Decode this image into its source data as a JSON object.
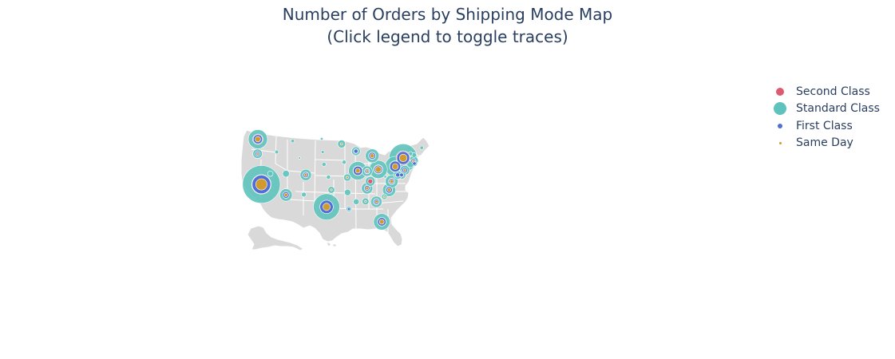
{
  "chart": {
    "title_line1": "Number of Orders by Shipping Mode Map",
    "title_line2": "(Click legend to toggle traces)"
  },
  "colors": {
    "land": "#d9d9d9",
    "borders": "#ffffff",
    "second_class": "#dc5b71",
    "standard_class": "#5fc3bd",
    "first_class": "#4f6fd6",
    "same_day": "#d09a2c",
    "text": "#2a3f5f"
  },
  "chart_data": {
    "type": "scatter_geo",
    "scope": "usa",
    "title": "Number of Orders by Shipping Mode Map\n(Click legend to toggle traces)",
    "legend_position": "top-right",
    "series": [
      {
        "name": "Second Class",
        "color": "#dc5b71",
        "points": [
          {
            "state": "California",
            "lon": -119.4,
            "lat": 36.8,
            "value": 320
          },
          {
            "state": "New York",
            "lon": -75.0,
            "lat": 43.0,
            "value": 170
          },
          {
            "state": "Texas",
            "lon": -99.0,
            "lat": 31.5,
            "value": 150
          },
          {
            "state": "Pennsylvania",
            "lon": -77.5,
            "lat": 41.0,
            "value": 110
          },
          {
            "state": "Washington",
            "lon": -120.5,
            "lat": 47.4,
            "value": 90
          },
          {
            "state": "Illinois",
            "lon": -89.2,
            "lat": 40.0,
            "value": 80
          },
          {
            "state": "Ohio",
            "lon": -82.8,
            "lat": 40.3,
            "value": 70
          },
          {
            "state": "Florida",
            "lon": -81.7,
            "lat": 28.0,
            "value": 60
          },
          {
            "state": "Michigan",
            "lon": -84.7,
            "lat": 43.5,
            "value": 45
          },
          {
            "state": "North Carolina",
            "lon": -79.4,
            "lat": 35.5,
            "value": 40
          },
          {
            "state": "Virginia",
            "lon": -78.6,
            "lat": 37.5,
            "value": 35
          },
          {
            "state": "Arizona",
            "lon": -111.7,
            "lat": 34.3,
            "value": 35
          },
          {
            "state": "Georgia",
            "lon": -83.4,
            "lat": 32.7,
            "value": 30
          },
          {
            "state": "Tennessee",
            "lon": -86.3,
            "lat": 35.9,
            "value": 28
          },
          {
            "state": "Colorado",
            "lon": -105.5,
            "lat": 39.0,
            "value": 28
          },
          {
            "state": "Indiana",
            "lon": -86.3,
            "lat": 39.9,
            "value": 25
          },
          {
            "state": "Kentucky",
            "lon": -85.3,
            "lat": 37.5,
            "value": 20
          },
          {
            "state": "New Jersey",
            "lon": -74.5,
            "lat": 40.1,
            "value": 22
          },
          {
            "state": "Massachusetts",
            "lon": -71.8,
            "lat": 42.3,
            "value": 20
          },
          {
            "state": "Delaware",
            "lon": -75.5,
            "lat": 39.0,
            "value": 15
          },
          {
            "state": "Wisconsin",
            "lon": -89.8,
            "lat": 44.6,
            "value": 18
          },
          {
            "state": "Oregon",
            "lon": -120.6,
            "lat": 44.0,
            "value": 18
          }
        ]
      },
      {
        "name": "Standard Class",
        "color": "#5fc3bd",
        "points": [
          {
            "state": "California",
            "lon": -119.4,
            "lat": 36.8,
            "value": 1200
          },
          {
            "state": "New York",
            "lon": -75.0,
            "lat": 43.0,
            "value": 680
          },
          {
            "state": "Texas",
            "lon": -99.0,
            "lat": 31.5,
            "value": 590
          },
          {
            "state": "Pennsylvania",
            "lon": -77.5,
            "lat": 41.0,
            "value": 350
          },
          {
            "state": "Washington",
            "lon": -120.5,
            "lat": 47.4,
            "value": 310
          },
          {
            "state": "Illinois",
            "lon": -89.2,
            "lat": 40.0,
            "value": 290
          },
          {
            "state": "Ohio",
            "lon": -82.8,
            "lat": 40.3,
            "value": 280
          },
          {
            "state": "Florida",
            "lon": -81.7,
            "lat": 28.0,
            "value": 230
          },
          {
            "state": "Michigan",
            "lon": -84.7,
            "lat": 43.5,
            "value": 160
          },
          {
            "state": "North Carolina",
            "lon": -79.4,
            "lat": 35.5,
            "value": 150
          },
          {
            "state": "Virginia",
            "lon": -78.6,
            "lat": 37.5,
            "value": 140
          },
          {
            "state": "Arizona",
            "lon": -111.7,
            "lat": 34.3,
            "value": 130
          },
          {
            "state": "Georgia",
            "lon": -83.4,
            "lat": 32.7,
            "value": 110
          },
          {
            "state": "Tennessee",
            "lon": -86.3,
            "lat": 35.9,
            "value": 110
          },
          {
            "state": "Colorado",
            "lon": -105.5,
            "lat": 39.0,
            "value": 110
          },
          {
            "state": "Indiana",
            "lon": -86.3,
            "lat": 39.9,
            "value": 90
          },
          {
            "state": "Kentucky",
            "lon": -85.3,
            "lat": 37.5,
            "value": 80
          },
          {
            "state": "New Jersey",
            "lon": -74.5,
            "lat": 40.1,
            "value": 80
          },
          {
            "state": "Massachusetts",
            "lon": -71.8,
            "lat": 42.3,
            "value": 80
          },
          {
            "state": "Delaware",
            "lon": -75.5,
            "lat": 39.0,
            "value": 60
          },
          {
            "state": "Wisconsin",
            "lon": -89.8,
            "lat": 44.6,
            "value": 65
          },
          {
            "state": "Oregon",
            "lon": -120.6,
            "lat": 44.0,
            "value": 75
          },
          {
            "state": "Minnesota",
            "lon": -94.3,
            "lat": 46.3,
            "value": 55
          },
          {
            "state": "Missouri",
            "lon": -92.5,
            "lat": 38.4,
            "value": 45
          },
          {
            "state": "Alabama",
            "lon": -86.8,
            "lat": 32.8,
            "value": 40
          },
          {
            "state": "Mississippi",
            "lon": -89.7,
            "lat": 32.7,
            "value": 30
          },
          {
            "state": "Louisiana",
            "lon": -92.0,
            "lat": 31.0,
            "value": 25
          },
          {
            "state": "Oklahoma",
            "lon": -97.5,
            "lat": 35.5,
            "value": 40
          },
          {
            "state": "Arkansas",
            "lon": -92.4,
            "lat": 34.9,
            "value": 35
          },
          {
            "state": "South Carolina",
            "lon": -80.9,
            "lat": 33.9,
            "value": 25
          },
          {
            "state": "Rhode Island",
            "lon": -71.5,
            "lat": 41.7,
            "value": 30
          },
          {
            "state": "Connecticut",
            "lon": -72.7,
            "lat": 41.6,
            "value": 45
          },
          {
            "state": "Maryland",
            "lon": -76.7,
            "lat": 39.0,
            "value": 60
          },
          {
            "state": "Utah",
            "lon": -111.7,
            "lat": 39.3,
            "value": 40
          },
          {
            "state": "Nevada",
            "lon": -116.6,
            "lat": 39.3,
            "value": 25
          },
          {
            "state": "New Mexico",
            "lon": -106.1,
            "lat": 34.4,
            "value": 20
          },
          {
            "state": "Iowa",
            "lon": -93.5,
            "lat": 42.0,
            "value": 15
          },
          {
            "state": "Nebraska",
            "lon": -99.8,
            "lat": 41.5,
            "value": 15
          },
          {
            "state": "Idaho",
            "lon": -114.6,
            "lat": 44.4,
            "value": 12
          },
          {
            "state": "Montana",
            "lon": -109.6,
            "lat": 47.0,
            "value": 10
          },
          {
            "state": "Kansas",
            "lon": -98.4,
            "lat": 38.5,
            "value": 15
          },
          {
            "state": "New Hampshire",
            "lon": -71.6,
            "lat": 43.7,
            "value": 20
          },
          {
            "state": "Vermont",
            "lon": -72.7,
            "lat": 44.0,
            "value": 15
          },
          {
            "state": "Maine",
            "lon": -69.2,
            "lat": 45.4,
            "value": 10
          },
          {
            "state": "South Dakota",
            "lon": -100.2,
            "lat": 44.4,
            "value": 8
          },
          {
            "state": "North Dakota",
            "lon": -100.5,
            "lat": 47.5,
            "value": 6
          },
          {
            "state": "Wyoming",
            "lon": -107.5,
            "lat": 43.0,
            "value": 4
          },
          {
            "state": "West Virginia",
            "lon": -80.6,
            "lat": 38.6,
            "value": 6
          },
          {
            "state": "District of Columbia",
            "lon": -77.0,
            "lat": 38.9,
            "value": 10
          }
        ]
      },
      {
        "name": "First Class",
        "color": "#4f6fd6",
        "points": [
          {
            "state": "California",
            "lon": -119.4,
            "lat": 36.8,
            "value": 290
          },
          {
            "state": "New York",
            "lon": -75.0,
            "lat": 43.0,
            "value": 140
          },
          {
            "state": "Texas",
            "lon": -99.0,
            "lat": 31.5,
            "value": 150
          },
          {
            "state": "Pennsylvania",
            "lon": -77.5,
            "lat": 41.0,
            "value": 100
          },
          {
            "state": "Washington",
            "lon": -120.5,
            "lat": 47.4,
            "value": 70
          },
          {
            "state": "Illinois",
            "lon": -89.2,
            "lat": 40.0,
            "value": 70
          },
          {
            "state": "Ohio",
            "lon": -82.8,
            "lat": 40.3,
            "value": 60
          },
          {
            "state": "Florida",
            "lon": -81.7,
            "lat": 28.0,
            "value": 60
          },
          {
            "state": "Michigan",
            "lon": -84.7,
            "lat": 43.5,
            "value": 40
          },
          {
            "state": "North Carolina",
            "lon": -79.4,
            "lat": 35.5,
            "value": 35
          },
          {
            "state": "Virginia",
            "lon": -78.6,
            "lat": 37.5,
            "value": 30
          },
          {
            "state": "Arizona",
            "lon": -111.7,
            "lat": 34.3,
            "value": 35
          },
          {
            "state": "Colorado",
            "lon": -105.5,
            "lat": 39.0,
            "value": 25
          },
          {
            "state": "Tennessee",
            "lon": -86.3,
            "lat": 35.9,
            "value": 25
          },
          {
            "state": "Georgia",
            "lon": -83.4,
            "lat": 32.7,
            "value": 25
          },
          {
            "state": "Indiana",
            "lon": -86.3,
            "lat": 39.9,
            "value": 20
          },
          {
            "state": "New Jersey",
            "lon": -74.5,
            "lat": 40.1,
            "value": 25
          },
          {
            "state": "Massachusetts",
            "lon": -71.8,
            "lat": 42.3,
            "value": 20
          },
          {
            "state": "Delaware",
            "lon": -75.5,
            "lat": 39.0,
            "value": 12
          },
          {
            "state": "Wisconsin",
            "lon": -89.8,
            "lat": 44.6,
            "value": 15
          },
          {
            "state": "Oregon",
            "lon": -120.6,
            "lat": 44.0,
            "value": 20
          },
          {
            "state": "Maryland",
            "lon": -76.7,
            "lat": 39.0,
            "value": 15
          },
          {
            "state": "Rhode Island",
            "lon": -71.5,
            "lat": 41.7,
            "value": 10
          },
          {
            "state": "Louisiana",
            "lon": -92.0,
            "lat": 31.0,
            "value": 6
          }
        ]
      },
      {
        "name": "Same Day",
        "color": "#d09a2c",
        "points": [
          {
            "state": "California",
            "lon": -119.4,
            "lat": 36.8,
            "value": 110
          },
          {
            "state": "New York",
            "lon": -75.0,
            "lat": 43.0,
            "value": 50
          },
          {
            "state": "Texas",
            "lon": -99.0,
            "lat": 31.5,
            "value": 45
          },
          {
            "state": "Pennsylvania",
            "lon": -77.5,
            "lat": 41.0,
            "value": 30
          },
          {
            "state": "Washington",
            "lon": -120.5,
            "lat": 47.4,
            "value": 25
          },
          {
            "state": "Illinois",
            "lon": -89.2,
            "lat": 40.0,
            "value": 20
          },
          {
            "state": "Ohio",
            "lon": -82.8,
            "lat": 40.3,
            "value": 30
          },
          {
            "state": "Florida",
            "lon": -81.7,
            "lat": 28.0,
            "value": 20
          },
          {
            "state": "Michigan",
            "lon": -84.7,
            "lat": 43.5,
            "value": 15
          },
          {
            "state": "North Carolina",
            "lon": -79.4,
            "lat": 35.5,
            "value": 10
          },
          {
            "state": "Virginia",
            "lon": -78.6,
            "lat": 37.5,
            "value": 12
          },
          {
            "state": "Arizona",
            "lon": -111.7,
            "lat": 34.3,
            "value": 10
          },
          {
            "state": "Georgia",
            "lon": -83.4,
            "lat": 32.7,
            "value": 8
          },
          {
            "state": "Tennessee",
            "lon": -86.3,
            "lat": 35.9,
            "value": 8
          },
          {
            "state": "Colorado",
            "lon": -105.5,
            "lat": 39.0,
            "value": 8
          },
          {
            "state": "Indiana",
            "lon": -86.3,
            "lat": 39.9,
            "value": 6
          },
          {
            "state": "New Jersey",
            "lon": -74.5,
            "lat": 40.1,
            "value": 6
          },
          {
            "state": "Massachusetts",
            "lon": -71.8,
            "lat": 42.3,
            "value": 5
          },
          {
            "state": "Oregon",
            "lon": -120.6,
            "lat": 44.0,
            "value": 5
          },
          {
            "state": "Minnesota",
            "lon": -94.3,
            "lat": 46.3,
            "value": 4
          },
          {
            "state": "Missouri",
            "lon": -92.5,
            "lat": 38.4,
            "value": 4
          },
          {
            "state": "Oklahoma",
            "lon": -97.5,
            "lat": 35.5,
            "value": 3
          },
          {
            "state": "Alabama",
            "lon": -86.8,
            "lat": 32.8,
            "value": 3
          },
          {
            "state": "South Carolina",
            "lon": -80.9,
            "lat": 33.9,
            "value": 2
          }
        ]
      }
    ]
  },
  "legend": {
    "items": [
      {
        "label": "Second Class"
      },
      {
        "label": "Standard Class"
      },
      {
        "label": "First Class"
      },
      {
        "label": "Same Day"
      }
    ]
  }
}
